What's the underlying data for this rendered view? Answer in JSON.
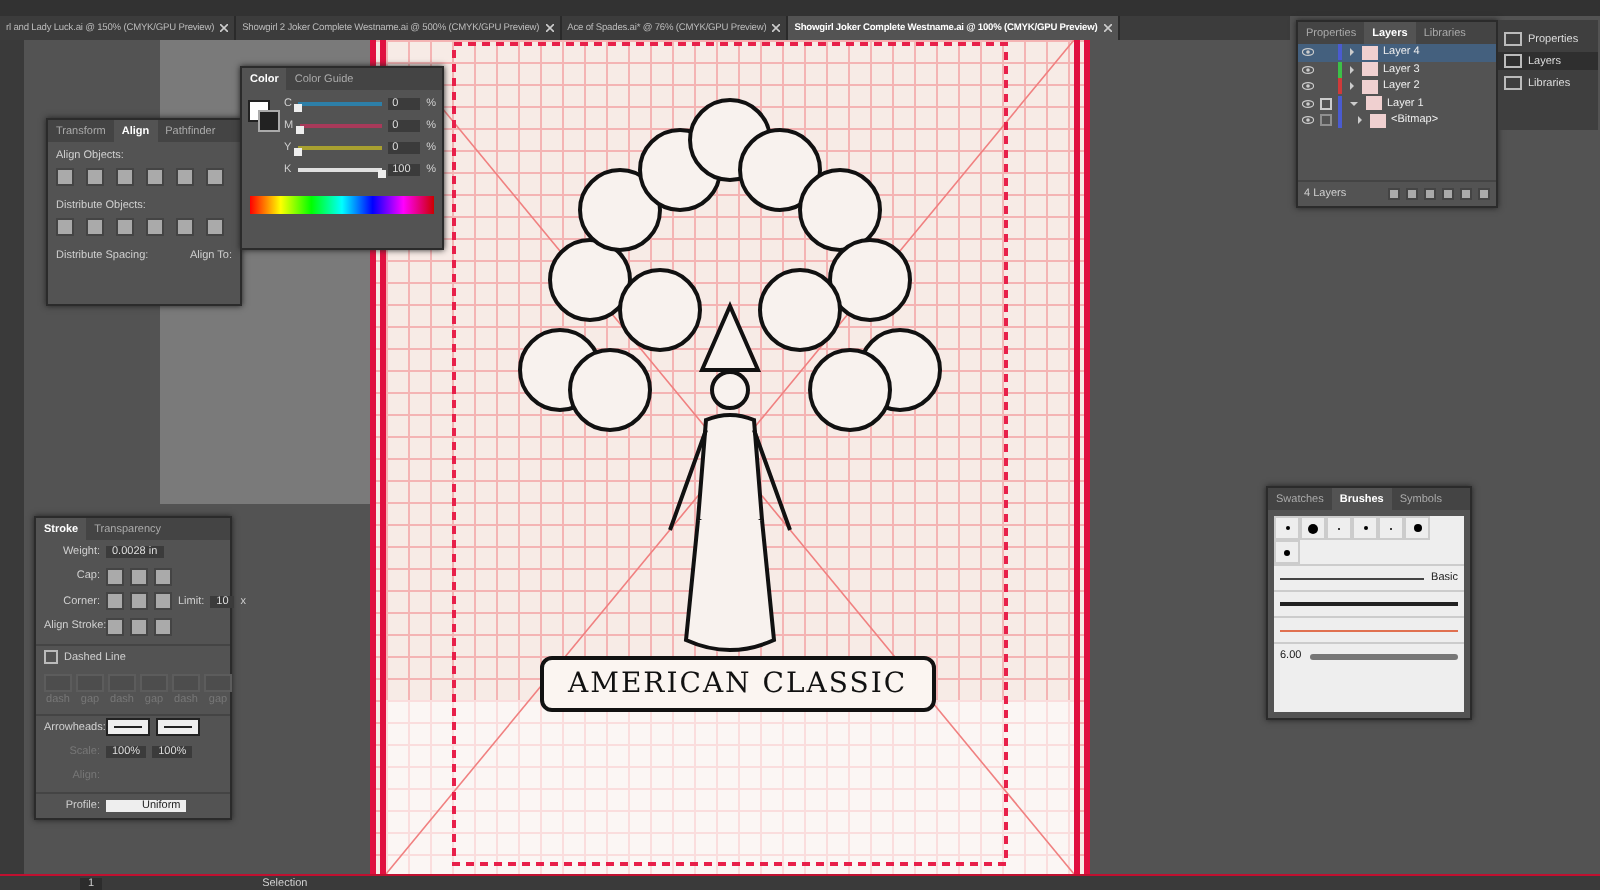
{
  "document_tabs": [
    {
      "label": "rl and Lady Luck.ai @ 150% (CMYK/GPU Preview)",
      "selected": false
    },
    {
      "label": "Showgirl 2 Joker Complete Westname.ai @ 500% (CMYK/GPU Preview)",
      "selected": false
    },
    {
      "label": "Ace of Spades.ai* @ 76% (CMYK/GPU Preview)",
      "selected": false
    },
    {
      "label": "Showgirl Joker Complete Westname.ai @ 100% (CMYK/GPU Preview)",
      "selected": true
    }
  ],
  "artwork": {
    "banner_text": "AMERICAN CLASSIC"
  },
  "color_panel": {
    "tabs": [
      {
        "label": "Color",
        "selected": true
      },
      {
        "label": "Color Guide",
        "selected": false
      }
    ],
    "channels": [
      {
        "label": "C",
        "value": "0",
        "unit": "%",
        "level": 0,
        "color": "#2d7fa8"
      },
      {
        "label": "M",
        "value": "0",
        "unit": "%",
        "level": 0,
        "color": "#a83a5a"
      },
      {
        "label": "Y",
        "value": "0",
        "unit": "%",
        "level": 0,
        "color": "#a8a030"
      },
      {
        "label": "K",
        "value": "100",
        "unit": "%",
        "level": 1,
        "color": "#e0e0e0"
      }
    ]
  },
  "align_panel": {
    "tabs": [
      {
        "label": "Transform",
        "selected": false
      },
      {
        "label": "Align",
        "selected": true
      },
      {
        "label": "Pathfinder",
        "selected": false
      }
    ],
    "sections": [
      "Align Objects:",
      "Distribute Objects:"
    ],
    "spacing_label": "Distribute Spacing:",
    "align_to_label": "Align To:"
  },
  "layers_panel": {
    "tabs": [
      {
        "label": "Properties",
        "selected": false
      },
      {
        "label": "Layers",
        "selected": true
      },
      {
        "label": "Libraries",
        "selected": false
      }
    ],
    "layers": [
      {
        "name": "Layer 4",
        "color": "#4a5bd0",
        "selected": true,
        "expanded": false,
        "locked": false
      },
      {
        "name": "Layer 3",
        "color": "#3cc048",
        "selected": false,
        "expanded": false,
        "locked": false
      },
      {
        "name": "Layer 2",
        "color": "#d03a3a",
        "selected": false,
        "expanded": false,
        "locked": false
      },
      {
        "name": "Layer 1",
        "color": "#4a5bd0",
        "selected": false,
        "expanded": true,
        "locked": true,
        "children": [
          {
            "name": "<Bitmap>",
            "color": "#4a5bd0",
            "selected": false,
            "expanded": false,
            "locked": true
          }
        ]
      }
    ],
    "count": "4 Layers"
  },
  "right_dock": [
    {
      "label": "Properties",
      "selected": false
    },
    {
      "label": "Layers",
      "selected": true
    },
    {
      "label": "Libraries",
      "selected": false
    }
  ],
  "stroke_panel": {
    "tabs": [
      {
        "label": "Stroke",
        "selected": true
      },
      {
        "label": "Transparency",
        "selected": false
      }
    ],
    "weight_label": "Weight:",
    "weight": "0.0028 in",
    "cap_label": "Cap:",
    "corner_label": "Corner:",
    "limit_label": "Limit:",
    "limit": "10",
    "limit_unit": "x",
    "align_stroke_label": "Align Stroke:",
    "dashed_line": {
      "label": "Dashed Line",
      "checked": false
    },
    "dash_gap": {
      "labels": [
        "dash",
        "gap",
        "dash",
        "gap",
        "dash",
        "gap"
      ],
      "disabled": true
    },
    "arrowheads_label": "Arrowheads:",
    "scale": {
      "label": "Scale:",
      "values": [
        "100%",
        "100%"
      ],
      "disabled": true
    },
    "align": {
      "label": "Align:",
      "disabled": true
    },
    "profile_label": "Profile:",
    "profile": "Uniform"
  },
  "brushes_panel": {
    "tabs": [
      {
        "label": "Swatches",
        "selected": false
      },
      {
        "label": "Brushes",
        "selected": true
      },
      {
        "label": "Symbols",
        "selected": false
      }
    ],
    "basic_label": "Basic",
    "size_label": "6.00"
  },
  "status_bar": {
    "page": "1",
    "tool": "Selection"
  }
}
